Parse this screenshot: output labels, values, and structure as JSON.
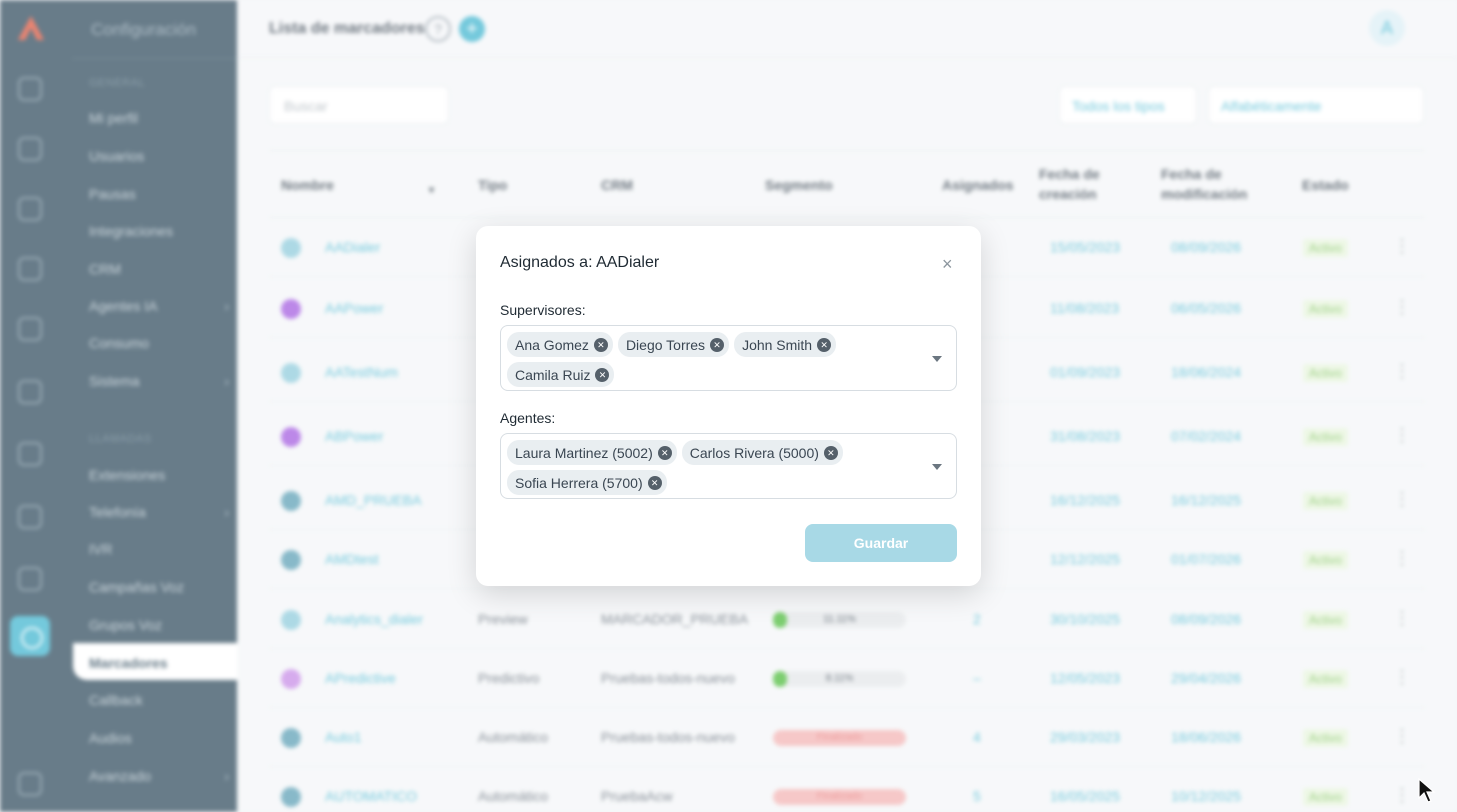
{
  "sidebar": {
    "title": "Configuración",
    "section_general": "GENERAL",
    "section_llamadas": "LLAMADAS",
    "items": [
      {
        "label": "Mi perfil"
      },
      {
        "label": "Usuarios"
      },
      {
        "label": "Pausas"
      },
      {
        "label": "Integraciones"
      },
      {
        "label": "CRM"
      },
      {
        "label": "Agentes IA"
      },
      {
        "label": "Consumo"
      },
      {
        "label": "Sistema"
      },
      {
        "label": "Extensiones"
      },
      {
        "label": "Telefonía"
      },
      {
        "label": "IVR"
      },
      {
        "label": "Campañas Voz"
      },
      {
        "label": "Grupos Voz"
      },
      {
        "label": "Marcadores"
      },
      {
        "label": "Callback"
      },
      {
        "label": "Audios"
      },
      {
        "label": "Avanzado"
      }
    ]
  },
  "header": {
    "title": "Lista de marcadores",
    "help": "?",
    "add": "+",
    "avatar": "A"
  },
  "filters": {
    "search_placeholder": "Buscar",
    "type_filter": "Todos los tipos",
    "sort": "Alfabéticamente"
  },
  "table": {
    "columns": [
      "Nombre",
      "Tipo",
      "CRM",
      "Segmento",
      "Asignados",
      "Fecha de creación",
      "Fecha de modificación",
      "Estado"
    ],
    "rows": [
      {
        "name": "AADialer",
        "tipo": "",
        "crm": "",
        "asig": "",
        "created": "15/05/2023",
        "modified": "08/09/2026",
        "status": "Activo"
      },
      {
        "name": "AAPower",
        "tipo": "",
        "crm": "",
        "asig": "",
        "created": "11/08/2023",
        "modified": "06/05/2026",
        "status": "Activo"
      },
      {
        "name": "AATestNum",
        "tipo": "",
        "crm": "",
        "asig": "",
        "created": "01/09/2023",
        "modified": "18/06/2024",
        "status": "Activo"
      },
      {
        "name": "ABPower",
        "tipo": "",
        "crm": "",
        "asig": "",
        "created": "31/08/2023",
        "modified": "07/02/2024",
        "status": "Activo"
      },
      {
        "name": "AMD_PRUEBA",
        "tipo": "",
        "crm": "",
        "asig": "",
        "created": "16/12/2025",
        "modified": "16/12/2025",
        "status": "Activo"
      },
      {
        "name": "AMDtest",
        "tipo": "",
        "crm": "",
        "asig": "",
        "created": "12/12/2025",
        "modified": "01/07/2026",
        "status": "Activo"
      },
      {
        "name": "Analytics_dialer",
        "tipo": "Preview",
        "crm": "MARCADOR_PRUEBA",
        "segment": "11.11%",
        "asig": "2",
        "created": "30/10/2025",
        "modified": "08/09/2026",
        "status": "Activo"
      },
      {
        "name": "APredictive",
        "tipo": "Predictivo",
        "crm": "Pruebas-todos-nuevo",
        "segment": "8.11%",
        "asig": "–",
        "created": "12/05/2023",
        "modified": "29/04/2026",
        "status": "Activo"
      },
      {
        "name": "Auto1",
        "tipo": "Automático",
        "crm": "Pruebas-todos-nuevo",
        "segment": "Finalizado",
        "asig": "4",
        "created": "29/03/2023",
        "modified": "18/06/2026",
        "status": "Activo"
      },
      {
        "name": "AUTOMATICO",
        "tipo": "Automático",
        "crm": "PruebaAcw",
        "segment": "Finalizado",
        "asig": "5",
        "created": "16/05/2025",
        "modified": "10/12/2025",
        "status": "Activo"
      }
    ]
  },
  "modal": {
    "title": "Asignados a: AADialer",
    "close": "×",
    "supervisors_label": "Supervisores:",
    "supervisors": [
      "Ana Gomez",
      "Diego Torres",
      "John Smith",
      "Camila Ruiz"
    ],
    "agents_label": "Agentes:",
    "agents": [
      "Laura Martinez (5002)",
      "Carlos Rivera (5000)",
      "Sofia Herrera (5700)"
    ],
    "save": "Guardar"
  }
}
